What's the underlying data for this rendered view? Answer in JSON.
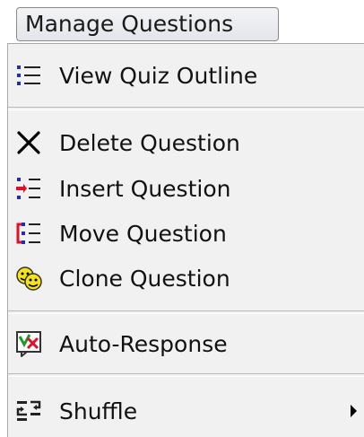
{
  "menu_button": {
    "label": "Manage Questions"
  },
  "menu": {
    "items": [
      {
        "label": "View Quiz Outline",
        "icon": "outline-list-icon"
      },
      {
        "label": "Delete Question",
        "icon": "delete-x-icon"
      },
      {
        "label": "Insert Question",
        "icon": "insert-list-icon"
      },
      {
        "label": "Move Question",
        "icon": "move-list-icon"
      },
      {
        "label": "Clone Question",
        "icon": "clone-faces-icon"
      },
      {
        "label": "Auto-Response",
        "icon": "auto-response-icon"
      },
      {
        "label": "Shuffle",
        "icon": "shuffle-icon"
      }
    ]
  },
  "colors": {
    "panel_bg": "#f1f1f1",
    "icon_blue": "#1f2fb4",
    "icon_red": "#e0102a",
    "icon_yellow": "#f6e21a",
    "icon_green": "#1c9a2a"
  }
}
